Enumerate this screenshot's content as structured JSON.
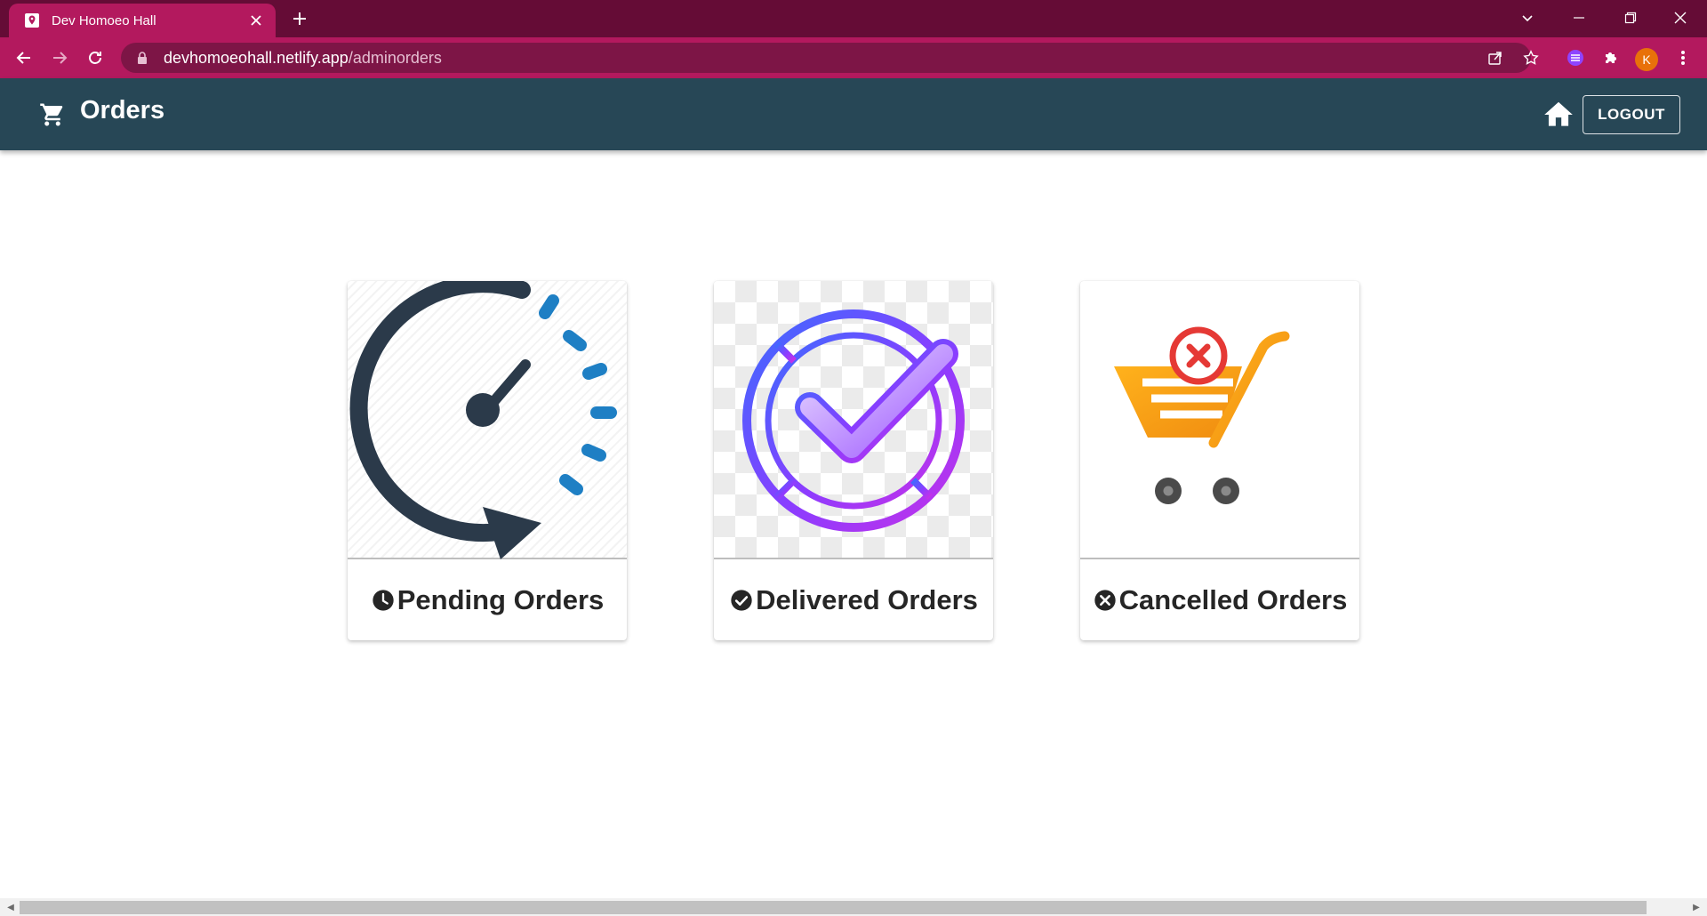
{
  "browser": {
    "tab_title": "Dev Homoeo Hall",
    "url_host": "devhomoeohall.netlify.app",
    "url_path": "/adminorders",
    "profile_initial": "K"
  },
  "appbar": {
    "title": "Orders",
    "logout_label": "LOGOUT"
  },
  "cards": [
    {
      "label": "Pending Orders",
      "icon": "clock-icon"
    },
    {
      "label": "Delivered Orders",
      "icon": "check-circle-icon"
    },
    {
      "label": "Cancelled Orders",
      "icon": "cancel-circle-icon"
    }
  ],
  "colors": {
    "tab_strip": "#650c36",
    "toolbar": "#b3195e",
    "appbar": "#274756",
    "accent_blue": "#1e7fc4",
    "cart_orange": "#f7a21b",
    "cancel_red": "#e53935"
  }
}
